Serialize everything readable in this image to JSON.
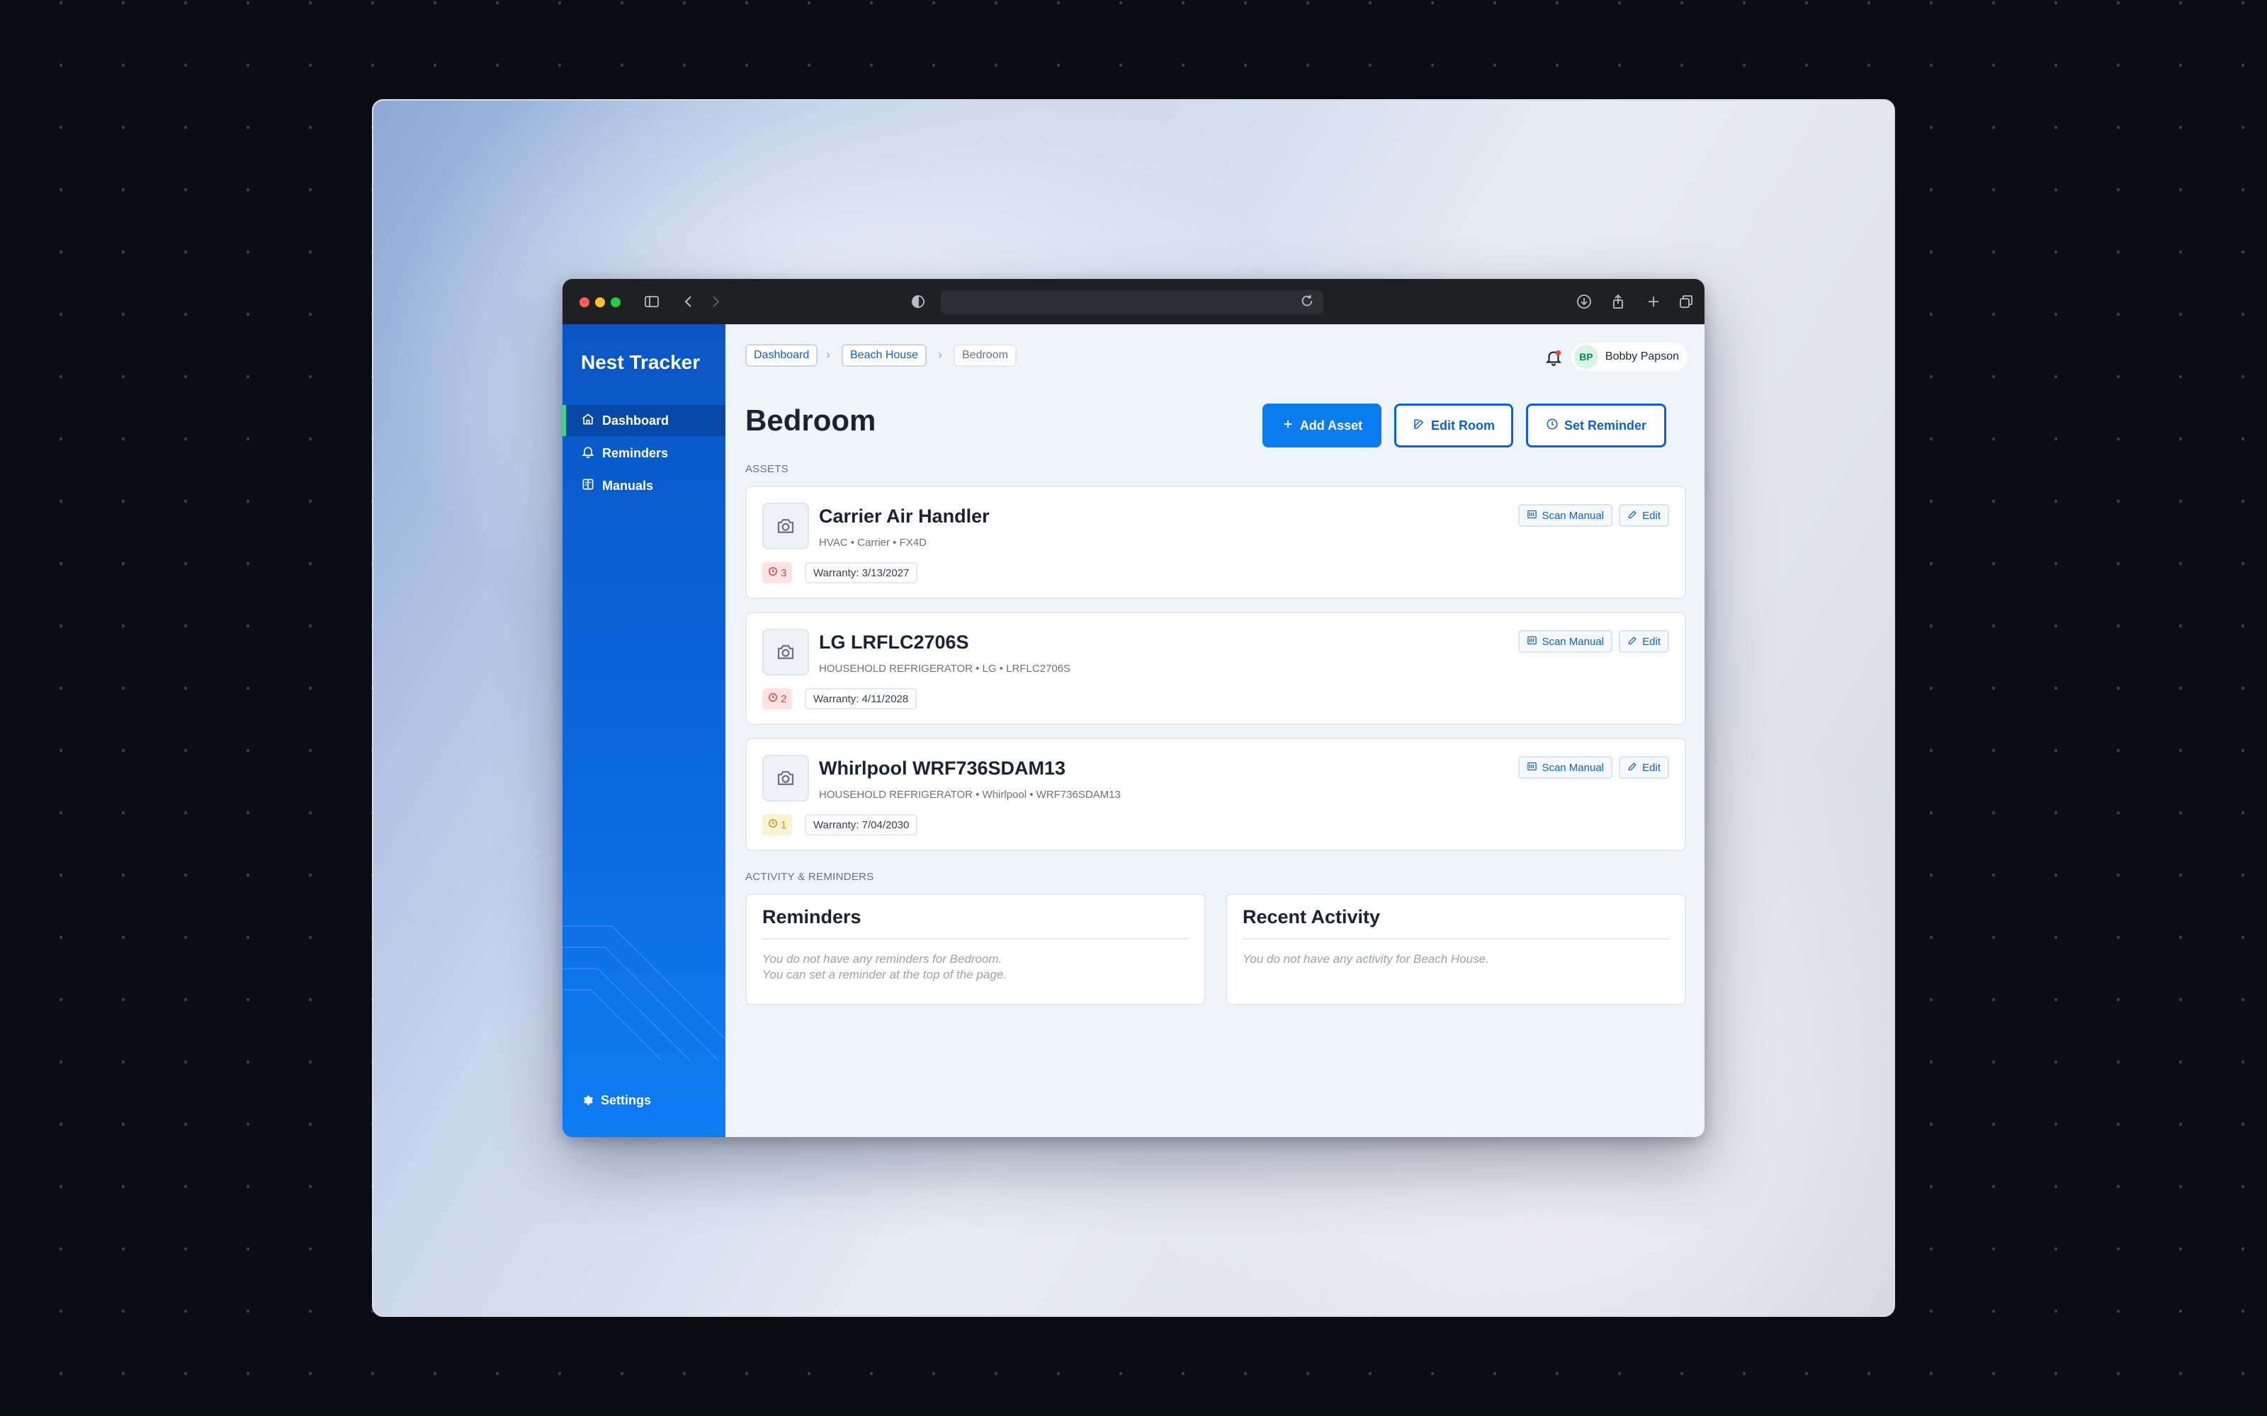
{
  "app": {
    "name": "Nest Tracker"
  },
  "sidebar": {
    "items": [
      {
        "label": "Dashboard",
        "icon": "home-icon",
        "active": true
      },
      {
        "label": "Reminders",
        "icon": "bell-icon",
        "active": false
      },
      {
        "label": "Manuals",
        "icon": "book-icon",
        "active": false
      }
    ],
    "settings_label": "Settings"
  },
  "breadcrumb": [
    "Dashboard",
    "Beach House",
    "Bedroom"
  ],
  "user": {
    "initials": "BP",
    "name": "Bobby Papson"
  },
  "page": {
    "title": "Bedroom"
  },
  "actions": {
    "add_asset": "Add Asset",
    "edit_room": "Edit Room",
    "set_reminder": "Set Reminder"
  },
  "assets_label": "ASSETS",
  "assets": [
    {
      "name": "Carrier Air Handler",
      "meta": "HVAC • Carrier • FX4D",
      "count": "3",
      "count_level": "red",
      "warranty": "Warranty: 3/13/2027",
      "scan_label": "Scan Manual",
      "edit_label": "Edit"
    },
    {
      "name": "LG LRFLC2706S",
      "meta": "HOUSEHOLD REFRIGERATOR • LG • LRFLC2706S",
      "count": "2",
      "count_level": "red",
      "warranty": "Warranty: 4/11/2028",
      "scan_label": "Scan Manual",
      "edit_label": "Edit"
    },
    {
      "name": "Whirlpool WRF736SDAM13",
      "meta": "HOUSEHOLD REFRIGERATOR • Whirlpool • WRF736SDAM13",
      "count": "1",
      "count_level": "yellow",
      "warranty": "Warranty: 7/04/2030",
      "scan_label": "Scan Manual",
      "edit_label": "Edit"
    }
  ],
  "activity_label": "ACTIVITY & REMINDERS",
  "reminders_panel": {
    "title": "Reminders",
    "line1": "You do not have any reminders for Bedroom.",
    "line2": "You can set a reminder at the top of the page."
  },
  "activity_panel": {
    "title": "Recent Activity",
    "line1": "You do not have any activity for Beach House."
  },
  "colors": {
    "sidebar": "#0a56c4",
    "accent": "#0b7bf0",
    "active_indicator": "#39d98a",
    "badge_red": "#d9443a",
    "badge_yellow": "#c99612"
  }
}
